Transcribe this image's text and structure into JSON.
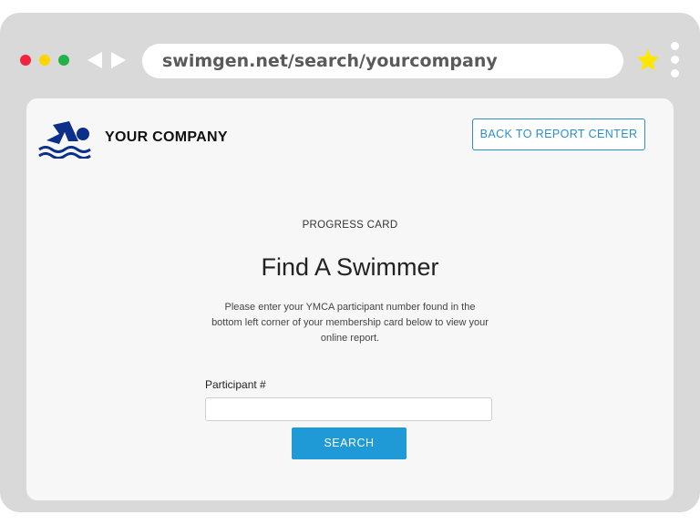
{
  "browser": {
    "url": "swimgen.net/search/yourcompany",
    "window_controls": [
      "close",
      "minimize",
      "maximize"
    ],
    "icons": [
      "back-arrow-icon",
      "forward-arrow-icon",
      "star-icon",
      "kebab-menu-icon"
    ],
    "colors": {
      "close": "#f0243a",
      "minimize": "#ffd400",
      "maximize": "#21b34a",
      "star": "#ffe600"
    }
  },
  "header": {
    "logo_icon": "swimmer-icon",
    "brand": "YOUR COMPANY",
    "back_button": "BACK TO REPORT CENTER"
  },
  "main": {
    "eyebrow": "PROGRESS CARD",
    "title": "Find A Swimmer",
    "instructions": "Please enter your YMCA participant number found in the bottom left corner of your membership card below to view your online report.",
    "field_label": "Participant #",
    "field_value": "",
    "search_button": "SEARCH"
  },
  "colors": {
    "accent": "#1f9ad6",
    "logo": "#0b2f8a"
  }
}
